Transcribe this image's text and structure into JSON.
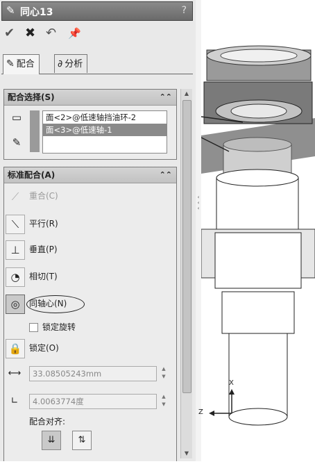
{
  "window": {
    "title": "同心13",
    "help": "?"
  },
  "actions": {
    "ok": "✔",
    "cancel": "✖",
    "undo": "↶",
    "pin": "📌"
  },
  "tabs": [
    {
      "label": "配合"
    },
    {
      "label": "分析"
    }
  ],
  "mate_selection": {
    "header": "配合选择(S)",
    "items": [
      "面<2>@低速轴挡油环-2",
      "面<3>@低速轴-1"
    ]
  },
  "standard_mates": {
    "header": "标准配合(A)",
    "coincident": "重合(C)",
    "parallel": "平行(R)",
    "perpendicular": "垂直(P)",
    "tangent": "相切(T)",
    "concentric": "同轴心(N)",
    "lock_rotation": "锁定旋转",
    "lock": "锁定(O)",
    "distance_value": "33.08505243mm",
    "angle_value": "4.0063774度",
    "alignment_label": "配合对齐:"
  },
  "triad": {
    "x": "X",
    "z": "Z"
  },
  "colors": {
    "title_bg": "#6f6f6f",
    "highlight": "#8a8a8a",
    "panel_bg": "#e9e9e9"
  }
}
